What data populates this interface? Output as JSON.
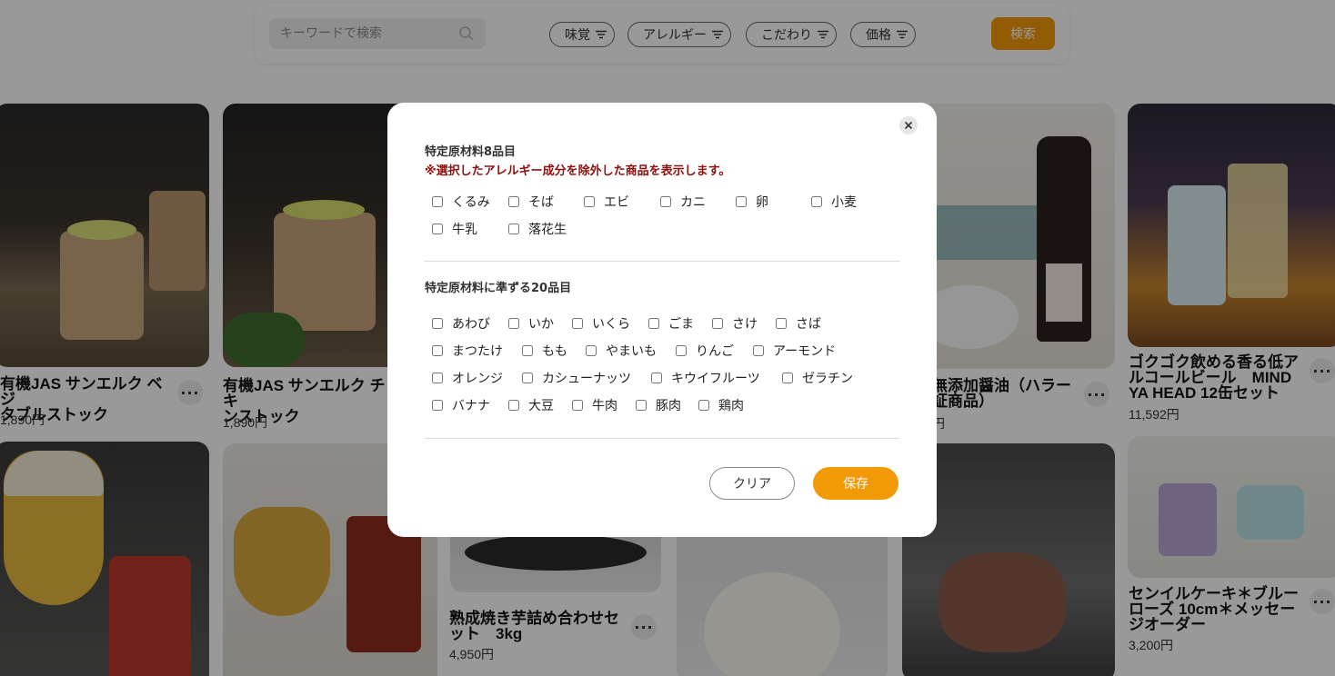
{
  "search": {
    "placeholder": "キーワードで検索",
    "filters": [
      "味覚",
      "アレルギー",
      "こだわり",
      "価格"
    ],
    "button_label": "検索"
  },
  "products": [
    {
      "title": "有機JAS サンエルク ベジ\nタブルストック",
      "price": "1,890円"
    },
    {
      "title": "有機JAS サンエルク チキ\nンストック",
      "price": "1,890円"
    },
    {
      "title": "無添加醤油（ハラー\n証商品）",
      "price": "円"
    },
    {
      "title": "ゴクゴク飲める香る低ア\nルコールビール　MIND\nYA HEAD 12缶セット",
      "price": "11,592円"
    },
    {
      "title": "熟成焼き芋詰め合わせセ\nット　3kg",
      "price": "4,950円"
    },
    {
      "title": "センイルケーキ＊ブルー\nローズ 10cm＊メッセー\nジオーダー",
      "price": "3,200円"
    }
  ],
  "modal": {
    "section1_title": "特定原材料8品目",
    "section1_note": "※選択したアレルギー成分を除外した商品を表示します。",
    "section1_items": [
      "くるみ",
      "そば",
      "エビ",
      "カニ",
      "卵",
      "小麦",
      "牛乳",
      "落花生"
    ],
    "section2_title": "特定原材料に準ずる20品目",
    "section2_items": [
      "あわび",
      "いか",
      "いくら",
      "ごま",
      "さけ",
      "さば",
      "まつたけ",
      "もも",
      "やまいも",
      "りんご",
      "アーモンド",
      "オレンジ",
      "カシューナッツ",
      "キウイフルーツ",
      "ゼラチン",
      "バナナ",
      "大豆",
      "牛肉",
      "豚肉",
      "鶏肉"
    ],
    "clear_label": "クリア",
    "save_label": "保存"
  },
  "colors": {
    "accent": "#f29a05",
    "note": "#8b1010"
  },
  "icons": {
    "search": "search-icon",
    "filter": "filter-lines-icon",
    "close": "close-icon",
    "more": "more-dots-icon"
  }
}
